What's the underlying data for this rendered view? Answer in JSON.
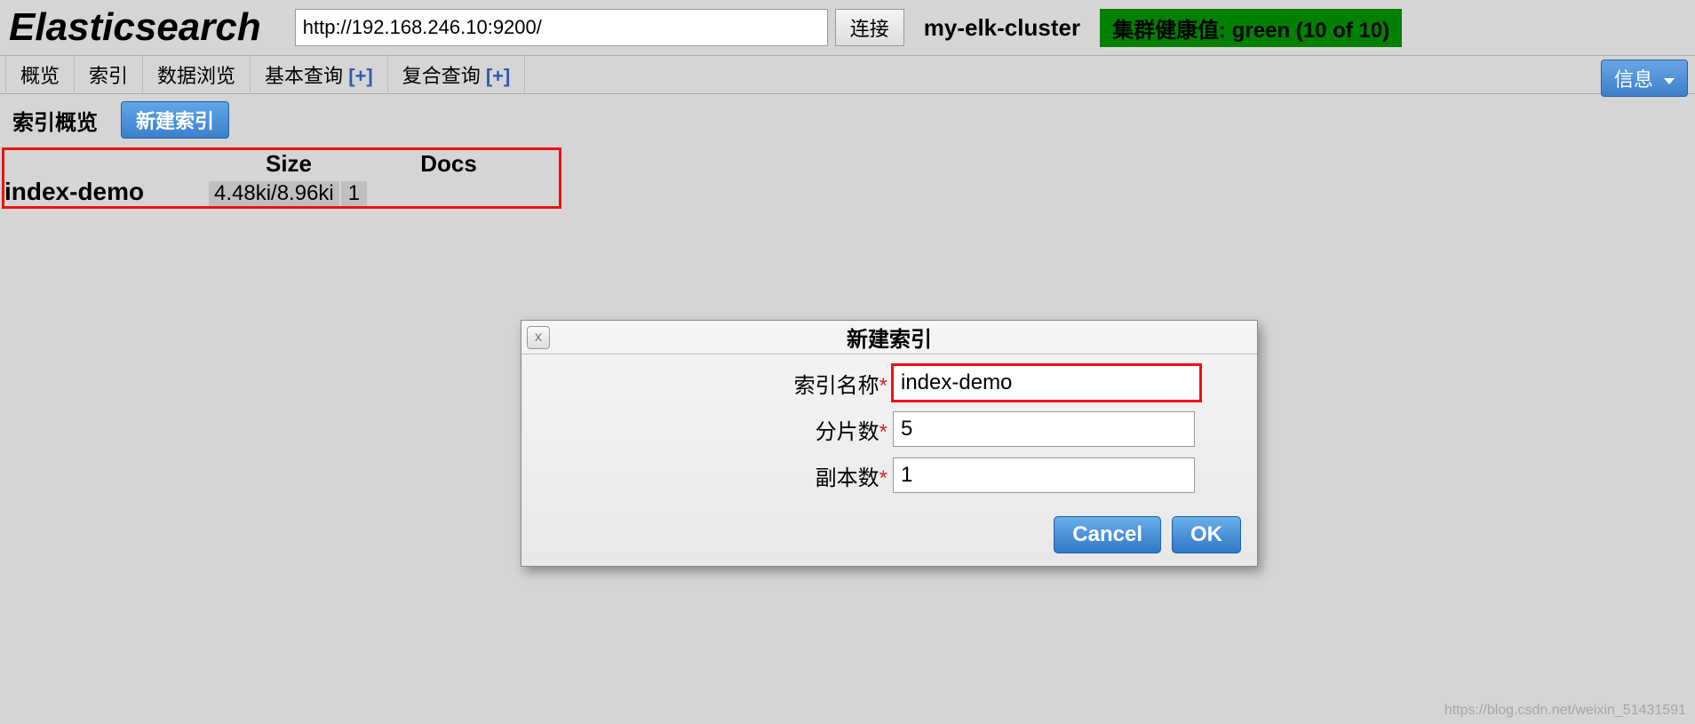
{
  "header": {
    "app_title": "Elasticsearch",
    "url_value": "http://192.168.246.10:9200/",
    "connect_label": "连接",
    "cluster_name": "my-elk-cluster",
    "health_label": "集群健康值: green (10 of 10)"
  },
  "tabs": {
    "overview": "概览",
    "index": "索引",
    "browse": "数据浏览",
    "basic_query": "基本查询",
    "basic_plus": "[+]",
    "compound_query": "复合查询",
    "compound_plus": "[+]",
    "info_button": "信息"
  },
  "subbar": {
    "title": "索引概览",
    "new_index_btn": "新建索引"
  },
  "index_table": {
    "headers": {
      "size": "Size",
      "docs": "Docs"
    },
    "rows": [
      {
        "name": "index-demo",
        "size": "4.48ki/8.96ki",
        "docs": "1"
      }
    ]
  },
  "dialog": {
    "title": "新建索引",
    "close_glyph": "x",
    "fields": {
      "name_label": "索引名称",
      "name_value": "index-demo",
      "shards_label": "分片数",
      "shards_value": "5",
      "replicas_label": "副本数",
      "replicas_value": "1"
    },
    "cancel": "Cancel",
    "ok": "OK"
  },
  "watermark": "https://blog.csdn.net/weixin_51431591"
}
